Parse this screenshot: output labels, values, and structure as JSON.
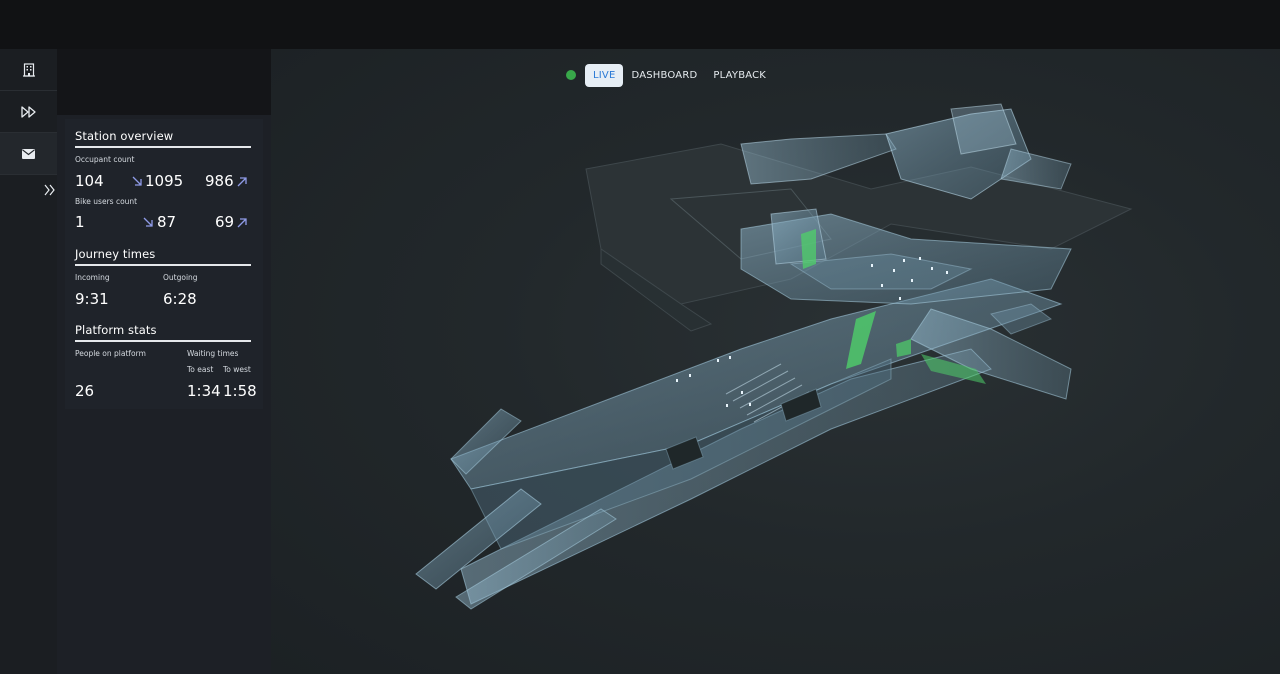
{
  "tabs": {
    "live": "LIVE",
    "dashboard": "DASHBOARD",
    "playback": "PLAYBACK"
  },
  "rail": {
    "icons": [
      "building-icon",
      "fast-forward-icon",
      "mail-icon",
      "expand-chevron-icon"
    ]
  },
  "station_overview": {
    "title": "Station overview",
    "occupant": {
      "label": "Occupant count",
      "current": "104",
      "incoming": "1095",
      "outgoing": "986"
    },
    "bike": {
      "label": "Bike users count",
      "current": "1",
      "incoming": "87",
      "outgoing": "69"
    }
  },
  "journey_times": {
    "title": "Journey times",
    "incoming_label": "Incoming",
    "incoming_value": "9:31",
    "outgoing_label": "Outgoing",
    "outgoing_value": "6:28"
  },
  "platform_stats": {
    "title": "Platform stats",
    "people_label": "People on platform",
    "people_value": "26",
    "waiting_label": "Waiting times",
    "east_label": "To east",
    "east_value": "1:34",
    "west_label": "To west",
    "west_value": "1:58"
  },
  "colors": {
    "accent": "#2a7ad6",
    "live": "#38a84a",
    "arrow": "#8f9be8",
    "highlight": "#4fd06a"
  }
}
